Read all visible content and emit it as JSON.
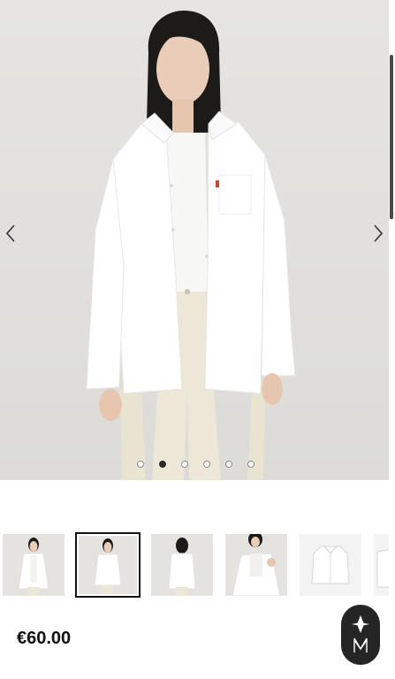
{
  "product": {
    "price": "€60.00"
  },
  "gallery": {
    "slide_count": 6,
    "active_slide": 2,
    "thumbnails": [
      {
        "name": "thumb-front-open"
      },
      {
        "name": "thumb-front-closed"
      },
      {
        "name": "thumb-back"
      },
      {
        "name": "thumb-off-shoulder"
      },
      {
        "name": "thumb-flat-lay"
      },
      {
        "name": "thumb-detail"
      }
    ],
    "selected_thumbnail": 2
  },
  "icons": {
    "prev": "chevron-left-icon",
    "next": "chevron-right-icon",
    "chat": "brand-chat-icon"
  },
  "colors": {
    "background": "#e2e1de",
    "shirt": "#ffffff",
    "pants": "#ece7d6",
    "accent": "#252525"
  }
}
